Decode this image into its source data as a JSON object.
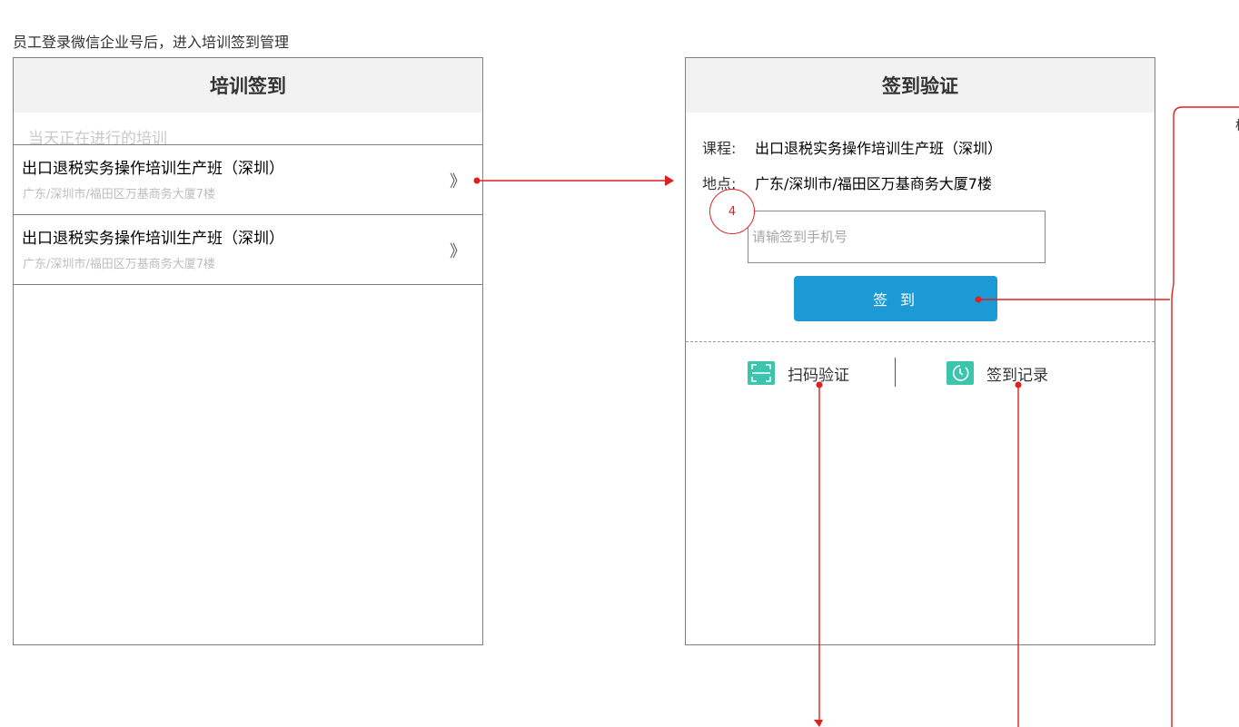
{
  "caption": "员工登录微信企业号后，进入培训签到管理",
  "left_screen": {
    "title": "培训签到",
    "section_label": "当天正在进行的培训",
    "items": [
      {
        "title": "出口退税实务操作培训生产班（深圳）",
        "address": "广东/深圳市/福田区万基商务大厦7楼",
        "chevron": "》"
      },
      {
        "title": "出口退税实务操作培训生产班（深圳）",
        "address": "广东/深圳市/福田区万基商务大厦7楼",
        "chevron": "》"
      }
    ]
  },
  "right_screen": {
    "title": "签到验证",
    "course_label": "课程:",
    "course_value": "出口退税实务操作培训生产班（深圳）",
    "location_label": "地点:",
    "location_value": "广东/深圳市/福田区万基商务大厦7楼",
    "phone_placeholder": "请输签到手机号",
    "signin_label": "签到",
    "scan_label": "扫码验证",
    "scan_icon": "scan-frame-icon",
    "record_label": "签到记录",
    "record_icon": "clock-icon"
  },
  "annotation": {
    "marker_number": "4",
    "side_text": "标\n注\n开\n者"
  },
  "colors": {
    "accent_button": "#1b9ad6",
    "icon_teal": "#3cc4ac",
    "annotation_red": "#e02020",
    "header_bg": "#f2f2f2"
  }
}
